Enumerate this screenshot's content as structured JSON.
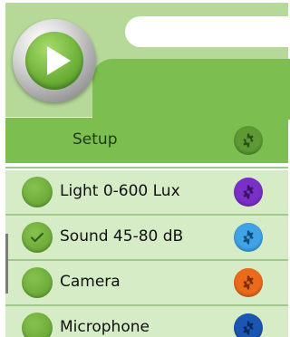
{
  "header": {
    "search_value": ""
  },
  "setup": {
    "title": "Setup"
  },
  "sensors": [
    {
      "label": "Light 0-600 Lux",
      "checked": false,
      "gear_color": "#7a2fc7"
    },
    {
      "label": "Sound 45-80 dB",
      "checked": true,
      "gear_color": "#3fa3e6"
    },
    {
      "label": "Camera",
      "checked": false,
      "gear_color": "#ec6a1c"
    },
    {
      "label": "Microphone",
      "checked": false,
      "gear_color": "#1b56b5"
    }
  ],
  "colors": {
    "header_light": "#b6d99a",
    "header_dark": "#7cbe4f",
    "row_bg": "#d6ecc6",
    "setup_gear": "#5d9a34"
  }
}
